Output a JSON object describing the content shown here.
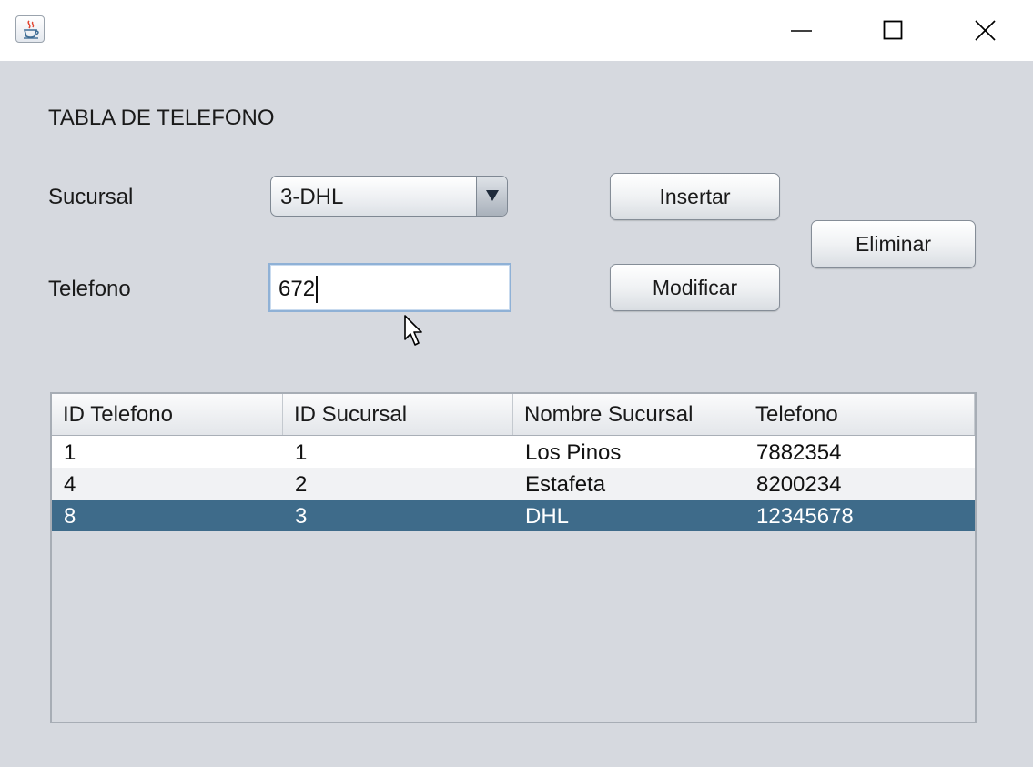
{
  "form": {
    "title": "TABLA DE TELEFONO",
    "sucursal_label": "Sucursal",
    "sucursal_selected": "3-DHL",
    "telefono_label": "Telefono",
    "telefono_value": "672"
  },
  "buttons": {
    "insertar": "Insertar",
    "modificar": "Modificar",
    "eliminar": "Eliminar"
  },
  "table": {
    "columns": [
      "ID Telefono",
      "ID Sucursal",
      "Nombre Sucursal",
      "Telefono"
    ],
    "rows": [
      [
        "1",
        "1",
        "Los Pinos",
        "7882354"
      ],
      [
        "4",
        "2",
        "Estafeta",
        "8200234"
      ],
      [
        "8",
        "3",
        "DHL",
        "12345678"
      ]
    ],
    "selected_row": 2
  },
  "icons": {
    "app": "java-coffee-cup-icon",
    "minimize": "minimize-icon",
    "maximize": "maximize-icon",
    "close": "close-icon",
    "dropdown": "dropdown-arrow-icon",
    "cursor": "mouse-pointer-icon"
  },
  "colors": {
    "window_bg": "#d6d9df",
    "row_even": "#ffffff",
    "row_odd": "#f1f2f4",
    "row_selected": "#3e6b8a",
    "selected_text": "#ffffff"
  }
}
